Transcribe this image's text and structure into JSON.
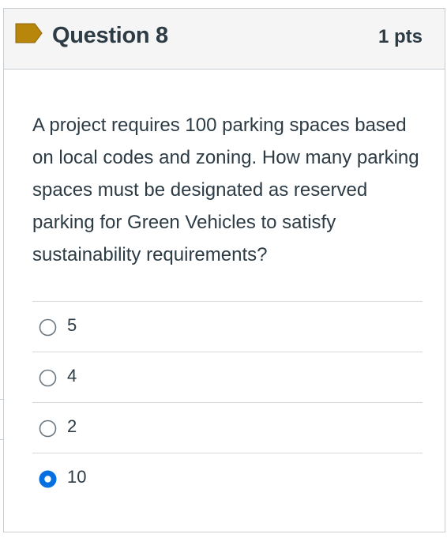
{
  "question": {
    "title": "Question 8",
    "points": "1 pts",
    "flag_icon": "flag-icon",
    "text": "A project requires 100 parking spaces based on local codes and zoning. How many parking spaces must be designated as reserved parking for Green Vehicles to satisfy sustainability requirements?"
  },
  "answers": [
    {
      "label": "5",
      "selected": false
    },
    {
      "label": "4",
      "selected": false
    },
    {
      "label": "2",
      "selected": false
    },
    {
      "label": "10",
      "selected": true
    }
  ],
  "colors": {
    "flag": "#b8860b",
    "radio_selected": "#0770e0",
    "text": "#2d3b45",
    "header_bg": "#f5f5f5"
  }
}
